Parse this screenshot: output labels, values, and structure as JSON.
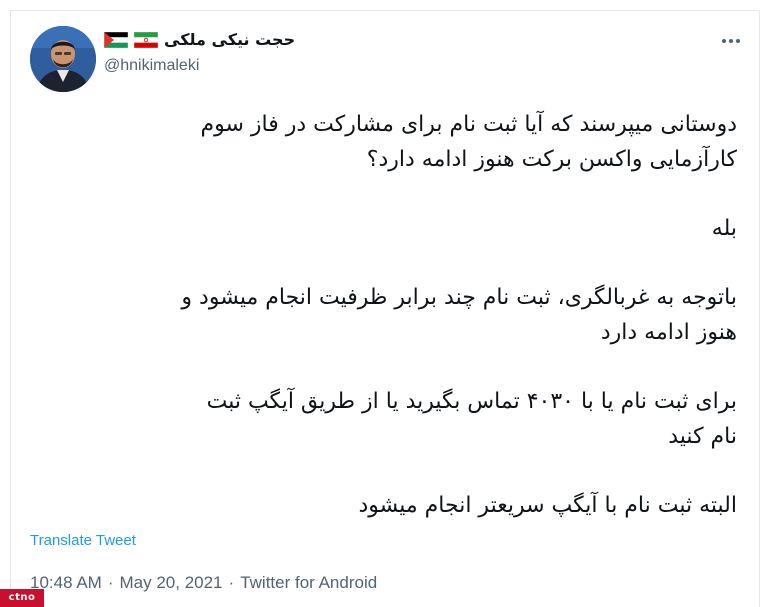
{
  "tweet": {
    "display_name": "حجت نیکی ملکی",
    "handle": "@hnikimaleki",
    "flags": [
      "iran-flag-icon",
      "palestine-flag-icon"
    ],
    "paragraphs": [
      [
        "دوستانی میپرسند که آیا ثبت نام برای مشارکت در فاز سوم",
        "کارآزمایی واکسن برکت هنوز ادامه دارد؟"
      ],
      [
        "بله"
      ],
      [
        "باتوجه به غربالگری، ثبت نام چند برابر ظرفیت انجام میشود و",
        "هنوز ادامه دارد"
      ],
      [
        "برای ثبت نام یا با ۴۰۳۰ تماس بگیرید یا از طریق  آیگپ ثبت",
        "نام کنید"
      ],
      [
        "البته ثبت نام با آیگپ سریعتر انجام میشود"
      ]
    ],
    "translate_label": "Translate Tweet",
    "time": "10:48 AM",
    "date": "May 20, 2021",
    "source": "Twitter for Android",
    "separator": "·"
  },
  "watermark": {
    "text": "ctno"
  },
  "colors": {
    "link": "#1d9bf0",
    "secondary_text": "#536471",
    "primary_text": "#0f1419",
    "border": "#e1e8ed",
    "watermark_bg": "#c8102e"
  }
}
